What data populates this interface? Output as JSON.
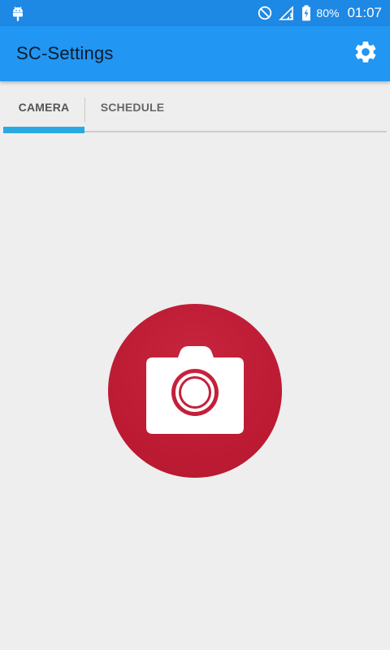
{
  "status_bar": {
    "battery_percent": "80%",
    "time": "01:07",
    "icons": [
      "android-icon",
      "do-not-disturb-icon",
      "signal-icon",
      "battery-charging-icon"
    ]
  },
  "app_bar": {
    "title": "SC-Settings",
    "settings_icon": "gear-icon"
  },
  "tabs": [
    {
      "label": "CAMERA",
      "selected": true
    },
    {
      "label": "SCHEDULE",
      "selected": false
    }
  ],
  "main": {
    "camera_button_icon": "camera-icon"
  },
  "colors": {
    "status_bar": "#1e88e5",
    "app_bar": "#2196f3",
    "tab_indicator": "#29a9e1",
    "camera_button": "#bb1a32",
    "background": "#eeeeee"
  }
}
